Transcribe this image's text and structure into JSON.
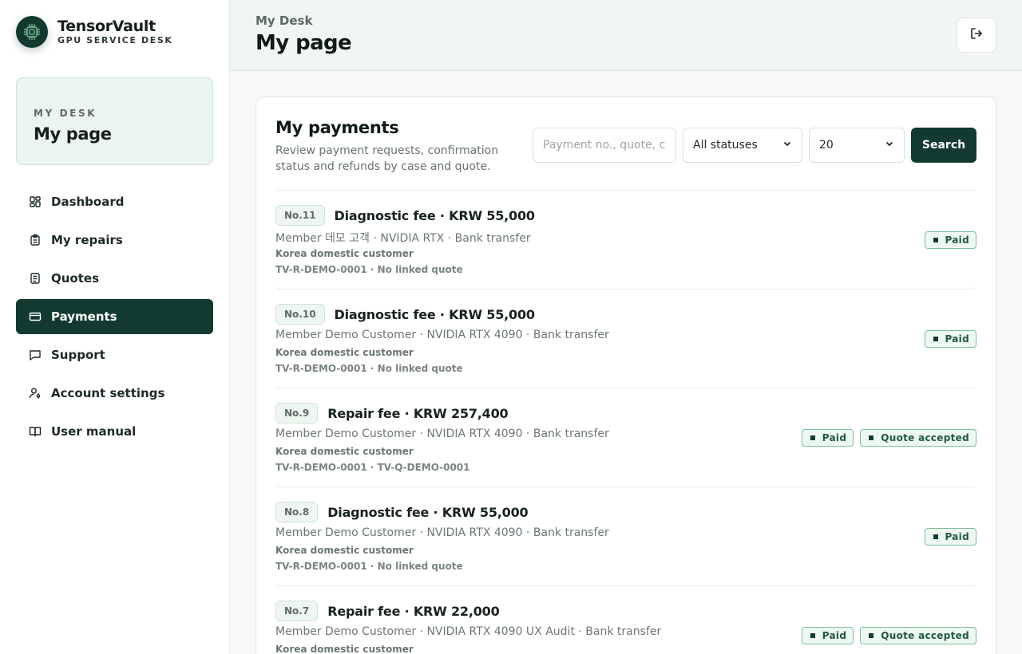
{
  "brand": {
    "name": "TensorVault",
    "subtitle": "GPU SERVICE DESK"
  },
  "desk_card": {
    "eyebrow": "MY DESK",
    "title": "My page"
  },
  "sidebar": {
    "items": [
      {
        "label": "Dashboard",
        "icon": "dashboard-icon",
        "active": false
      },
      {
        "label": "My repairs",
        "icon": "clipboard-icon",
        "active": false
      },
      {
        "label": "Quotes",
        "icon": "document-icon",
        "active": false
      },
      {
        "label": "Payments",
        "icon": "credit-card-icon",
        "active": true
      },
      {
        "label": "Support",
        "icon": "chat-icon",
        "active": false
      },
      {
        "label": "Account settings",
        "icon": "user-settings-icon",
        "active": false
      },
      {
        "label": "User manual",
        "icon": "book-icon",
        "active": false
      }
    ]
  },
  "header": {
    "breadcrumb": "My Desk",
    "title": "My page",
    "logout_icon": "logout-icon"
  },
  "panel": {
    "title": "My payments",
    "description": "Review payment requests, confirmation status and refunds by case and quote.",
    "search_placeholder": "Payment no., quote, case",
    "status_select": "All statuses",
    "page_size_select": "20",
    "search_button": "Search"
  },
  "payments": [
    {
      "no": "No.11",
      "title": "Diagnostic fee · KRW 55,000",
      "meta": "Member 데모 고객 · NVIDIA RTX · Bank transfer",
      "customer": "Korea domestic customer",
      "refs": "TV-R-DEMO-0001 · No linked quote",
      "badges": [
        "Paid"
      ]
    },
    {
      "no": "No.10",
      "title": "Diagnostic fee · KRW 55,000",
      "meta": "Member Demo Customer · NVIDIA RTX 4090 · Bank transfer",
      "customer": "Korea domestic customer",
      "refs": "TV-R-DEMO-0001 · No linked quote",
      "badges": [
        "Paid"
      ]
    },
    {
      "no": "No.9",
      "title": "Repair fee · KRW 257,400",
      "meta": "Member Demo Customer · NVIDIA RTX 4090 · Bank transfer",
      "customer": "Korea domestic customer",
      "refs": "TV-R-DEMO-0001 · TV-Q-DEMO-0001",
      "badges": [
        "Paid",
        "Quote accepted"
      ]
    },
    {
      "no": "No.8",
      "title": "Diagnostic fee · KRW 55,000",
      "meta": "Member Demo Customer · NVIDIA RTX 4090 · Bank transfer",
      "customer": "Korea domestic customer",
      "refs": "TV-R-DEMO-0001 · No linked quote",
      "badges": [
        "Paid"
      ]
    },
    {
      "no": "No.7",
      "title": "Repair fee · KRW 22,000",
      "meta": "Member Demo Customer · NVIDIA RTX 4090 UX Audit · Bank transfer",
      "customer": "Korea domestic customer",
      "refs": "",
      "badges": [
        "Paid",
        "Quote accepted"
      ]
    }
  ],
  "colors": {
    "accent": "#123a31",
    "badge_border": "#7bbf98",
    "badge_bg": "#eef8f2",
    "card_bg": "#e9f5ee"
  }
}
